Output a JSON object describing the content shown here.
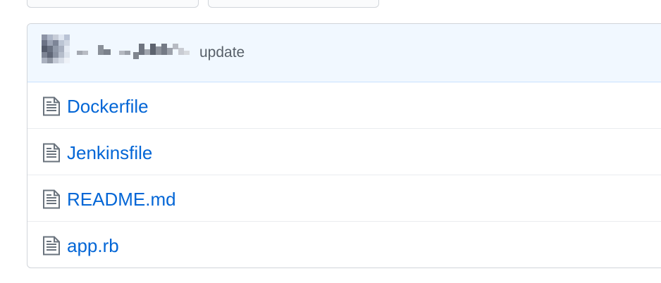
{
  "commit": {
    "message": "update"
  },
  "files": [
    {
      "name": "Dockerfile"
    },
    {
      "name": "Jenkinsfile"
    },
    {
      "name": "README.md"
    },
    {
      "name": "app.rb"
    }
  ],
  "colors": {
    "link": "#0366d6",
    "commit_bg": "#f1f8ff",
    "border": "#d1d5da",
    "muted_text": "#586069"
  },
  "icons": {
    "file": "file-icon"
  }
}
